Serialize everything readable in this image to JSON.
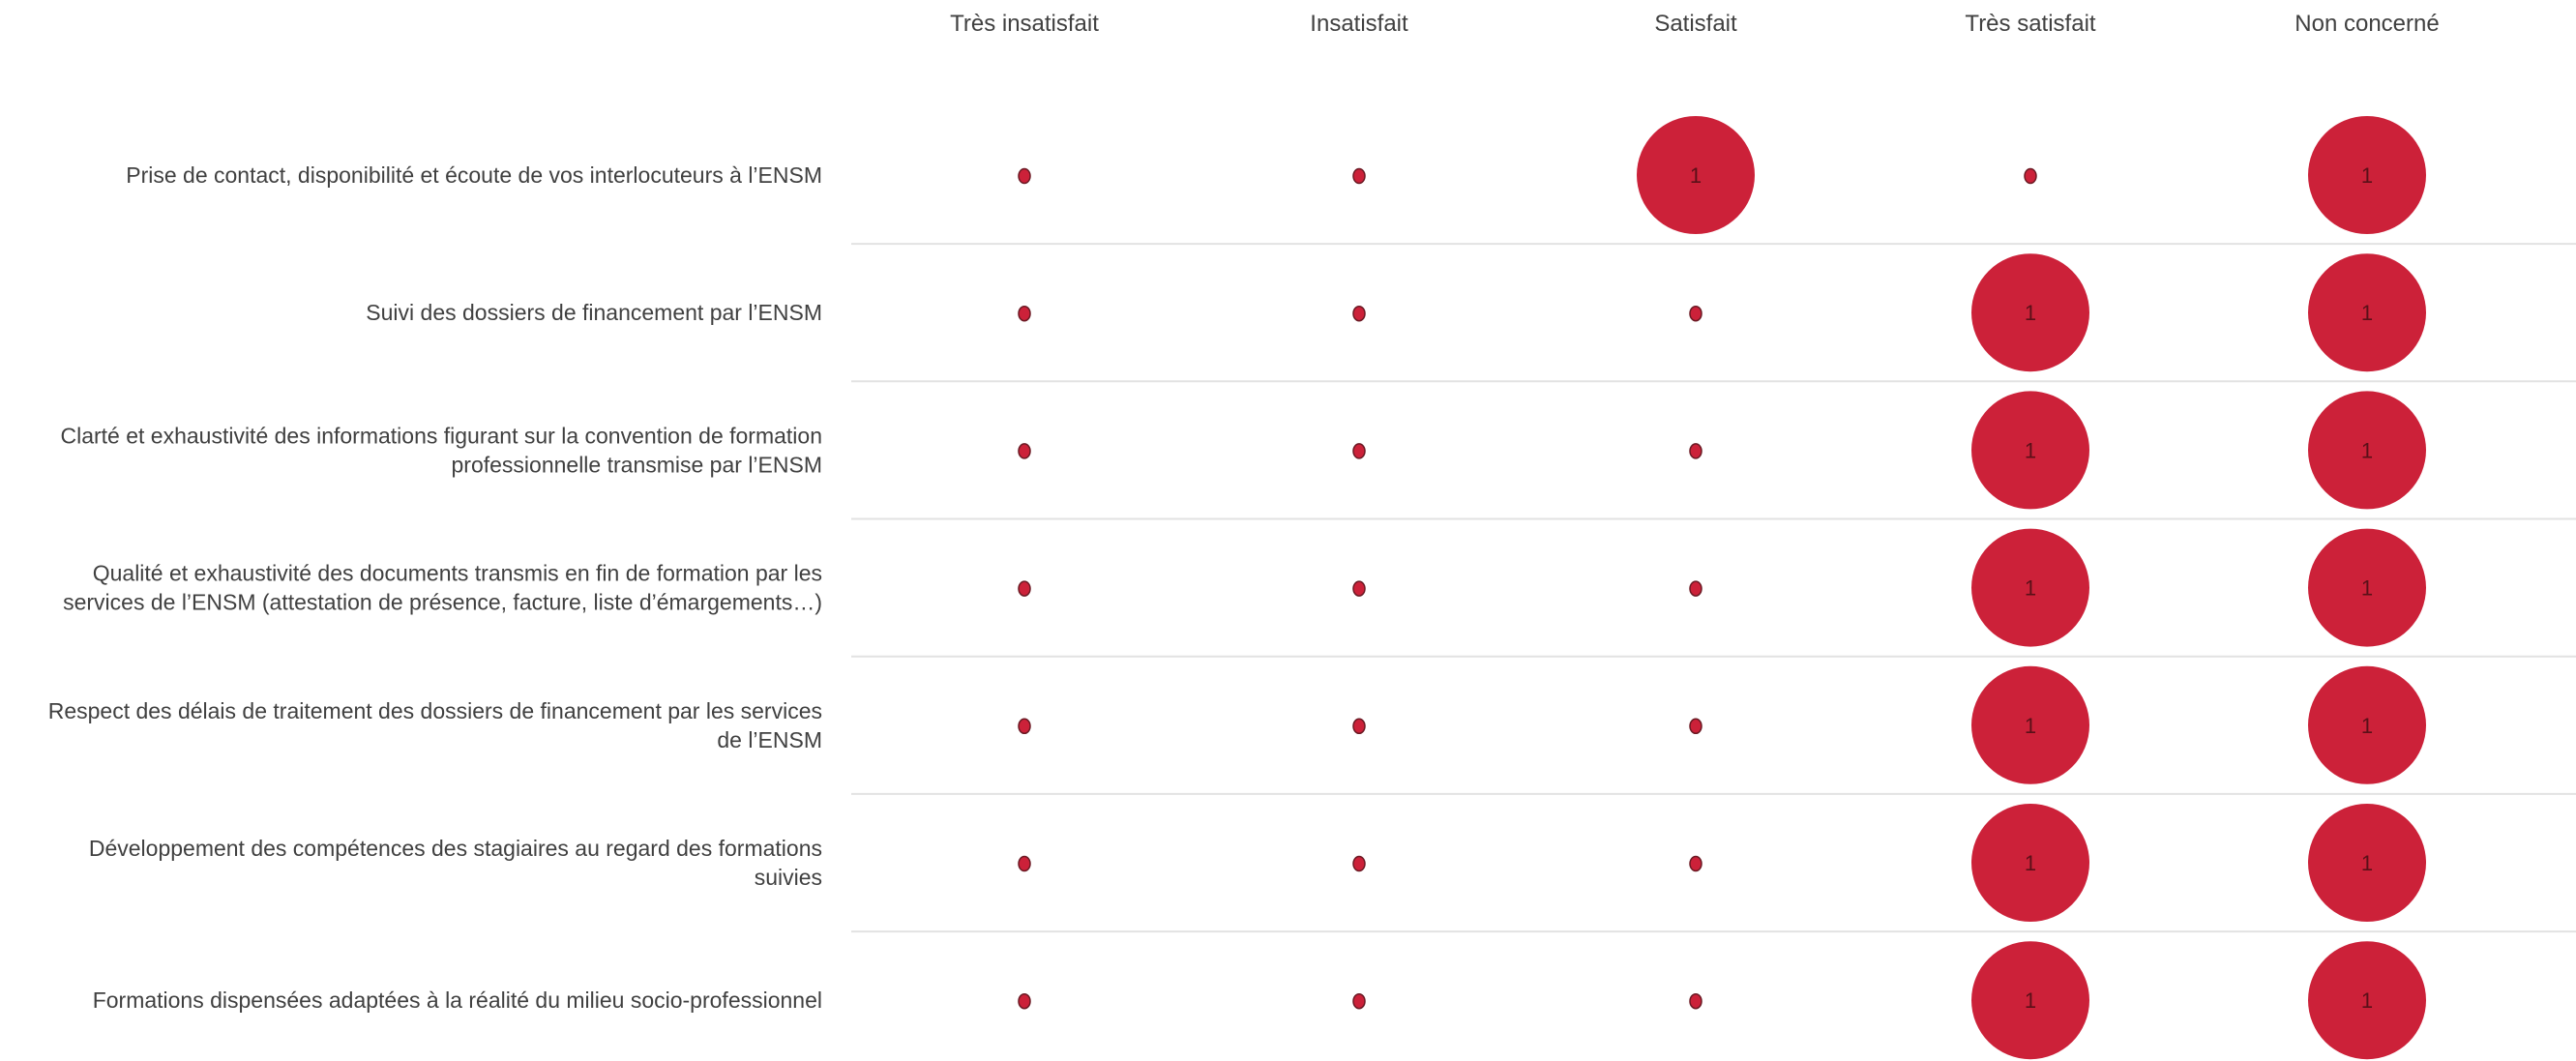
{
  "chart_data": {
    "type": "bubble-matrix",
    "columns": [
      "Très insatisfait",
      "Insatisfait",
      "Satisfait",
      "Très satisfait",
      "Non concerné"
    ],
    "rows": [
      {
        "label_lines": [
          "Prise de contact, disponibilité et écoute de vos interlocuteurs à l’ENSM"
        ],
        "values": [
          0,
          0,
          1,
          0,
          1
        ]
      },
      {
        "label_lines": [
          "Suivi des dossiers de financement par l’ENSM"
        ],
        "values": [
          0,
          0,
          0,
          1,
          1
        ]
      },
      {
        "label_lines": [
          "Clarté et exhaustivité des informations figurant sur la convention de formation",
          "professionnelle transmise par l’ENSM"
        ],
        "values": [
          0,
          0,
          0,
          1,
          1
        ]
      },
      {
        "label_lines": [
          "Qualité et exhaustivité des documents transmis en fin de formation par les",
          "services de l’ENSM (attestation de présence, facture, liste d’émargements…)"
        ],
        "values": [
          0,
          0,
          0,
          1,
          1
        ]
      },
      {
        "label_lines": [
          "Respect des délais de traitement des dossiers de financement par les services",
          "de l’ENSM"
        ],
        "values": [
          0,
          0,
          0,
          1,
          1
        ]
      },
      {
        "label_lines": [
          "Développement des compétences des stagiaires au regard des formations",
          "suivies"
        ],
        "values": [
          0,
          0,
          0,
          1,
          1
        ]
      },
      {
        "label_lines": [
          "Formations dispensées adaptées à la réalité du milieu socio-professionnel"
        ],
        "values": [
          0,
          0,
          0,
          1,
          1
        ]
      }
    ],
    "colors": {
      "bubble": "#cc2139",
      "bubble_text": "#5a1018",
      "empty_dot": "#cc2139",
      "empty_dot_stroke": "#6b1a24"
    }
  }
}
